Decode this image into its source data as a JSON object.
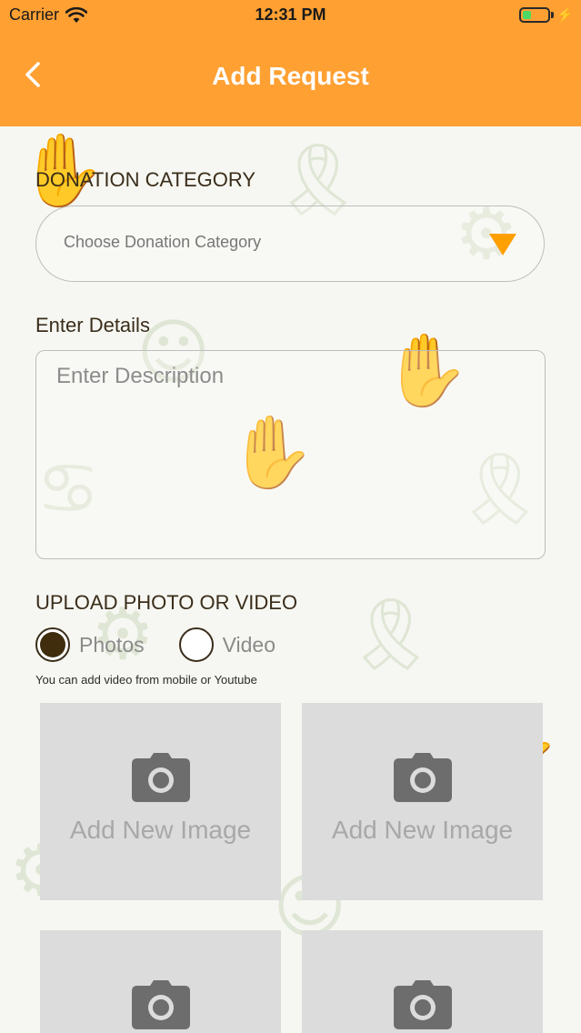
{
  "status_bar": {
    "carrier": "Carrier",
    "time": "12:31 PM"
  },
  "nav": {
    "title": "Add Request",
    "back_icon": "chevron-left-icon"
  },
  "form": {
    "category_label": "DONATION CATEGORY",
    "category_placeholder": "Choose Donation Category",
    "details_label": "Enter Details",
    "description_placeholder": "Enter Description",
    "upload_label": "UPLOAD PHOTO OR VIDEO",
    "media_options": [
      {
        "label": "Photos",
        "selected": true
      },
      {
        "label": "Video",
        "selected": false
      }
    ],
    "hint": "You can add video from mobile or Youtube"
  },
  "image_tiles": [
    {
      "label": "Add New Image"
    },
    {
      "label": "Add New Image"
    },
    {
      "label": ""
    },
    {
      "label": ""
    }
  ],
  "colors": {
    "header": "#ffa033",
    "dropdown_arrow": "#ffa000",
    "radio_selected": "#3f2d0e",
    "tile_background": "#dcdcdc"
  }
}
